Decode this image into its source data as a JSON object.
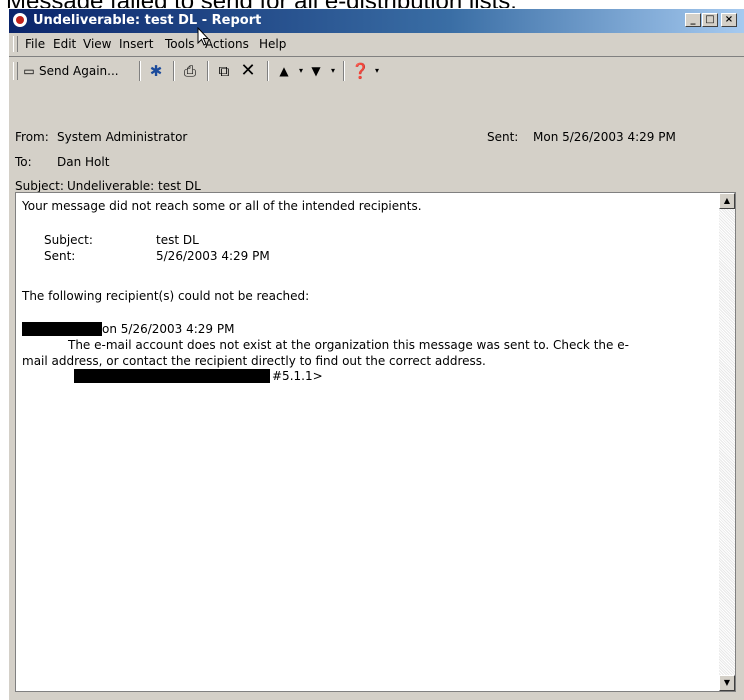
{
  "caption": "Message failed to send for all e-distribution lists.",
  "window": {
    "title": "Undeliverable: test DL - Report",
    "controls": [
      "_",
      "□",
      "×"
    ]
  },
  "menu": [
    "File",
    "Edit",
    "View",
    "Insert",
    "Tools",
    "Actions",
    "Help"
  ],
  "toolbar": {
    "send_again": "Send Again...",
    "icons": [
      "flag-icon",
      "print-icon",
      "move-icon",
      "delete-icon",
      "previous-icon",
      "next-icon",
      "help-icon"
    ]
  },
  "header": {
    "from_label": "From:",
    "from_value": "System Administrator",
    "to_label": "To:",
    "to_value": "Dan Holt",
    "subject_label": "Subject:",
    "subject_value": "Undeliverable: test DL",
    "sent_label": "Sent:",
    "sent_value": "Mon 5/26/2003 4:29 PM"
  },
  "body": {
    "intro": "Your message did not reach some or all of the intended recipients.",
    "subject_label": "Subject:",
    "subject_value": "test DL",
    "sent_label": "Sent:",
    "sent_value": "5/26/2003 4:29 PM",
    "unreached": "The following recipient(s) could not be reached:",
    "on_date": "on 5/26/2003 4:29 PM",
    "error_line1": "The e-mail account does not exist at the organization this message was sent to.  Check the e-",
    "error_line2": "mail address, or contact the recipient directly to find out the correct address.",
    "code": "#5.1.1>"
  }
}
